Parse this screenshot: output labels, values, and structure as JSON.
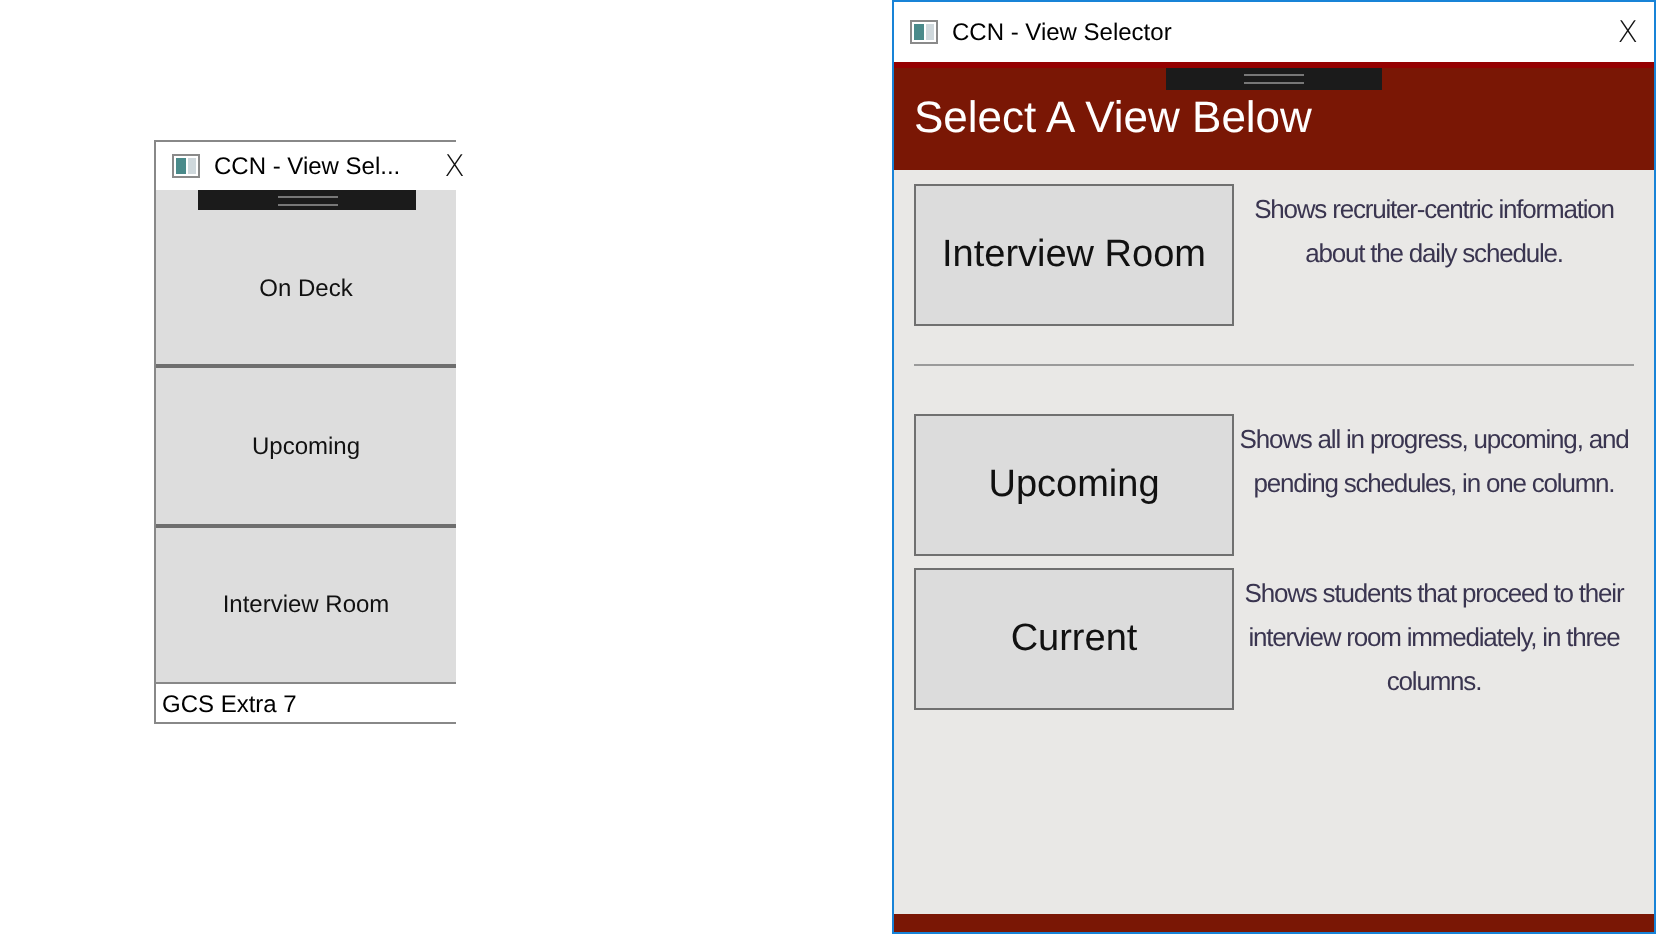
{
  "compact_window": {
    "title": "CCN - View Sel...",
    "close": "X",
    "buttons": [
      "On Deck",
      "Upcoming",
      "Interview Room"
    ],
    "status_bar": "GCS Extra 7"
  },
  "selector_window": {
    "title": "CCN - View Selector",
    "close": "X",
    "heading": "Select A View Below",
    "groups": [
      [
        {
          "button": "Interview Room",
          "description": "Shows recruiter-centric information about the daily schedule."
        }
      ],
      [
        {
          "button": "Upcoming",
          "description": "Shows all in progress, upcoming, and pending schedules, in one column."
        },
        {
          "button": "Current",
          "description": "Shows students that proceed to their interview room immediately, in three columns."
        }
      ]
    ]
  }
}
